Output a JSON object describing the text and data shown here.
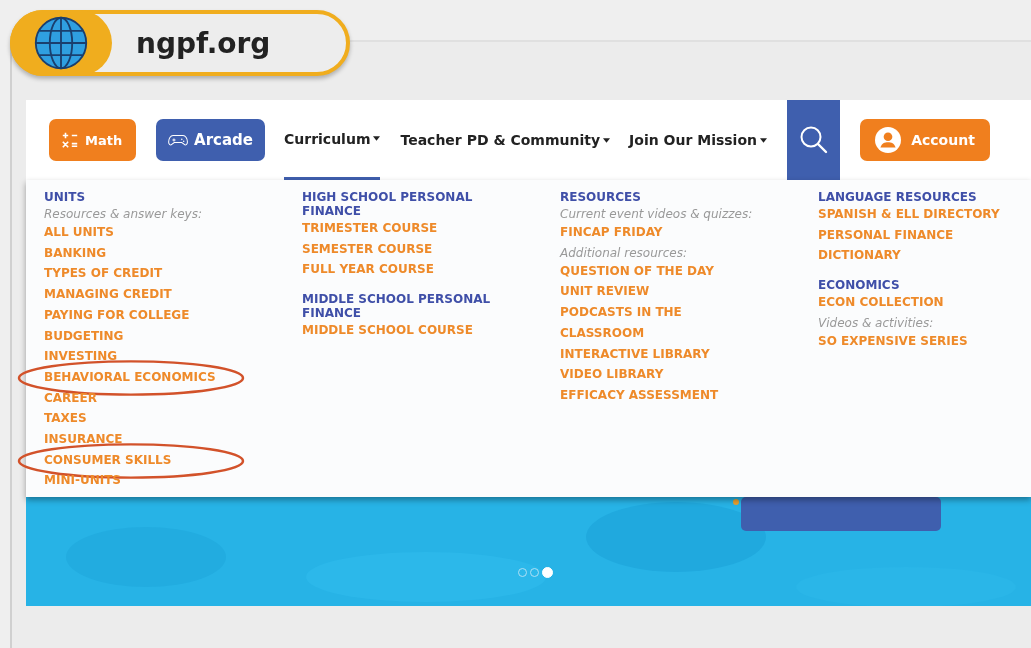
{
  "site_label": {
    "text": "ngpf.org"
  },
  "nav": {
    "buttons": [
      {
        "kind": "math",
        "label": "Math"
      },
      {
        "kind": "arcade",
        "label": "Arcade"
      }
    ],
    "menus": [
      {
        "label": "Curriculum",
        "selected": true
      },
      {
        "label": "Teacher PD & Community",
        "selected": false
      },
      {
        "label": "Join Our Mission",
        "selected": false
      }
    ],
    "account": {
      "label": "Account"
    }
  },
  "dropdown": {
    "columns": [
      {
        "sections": [
          {
            "heading": "UNITS",
            "items": [
              {
                "kind": "note",
                "text": "Resources & answer keys:"
              },
              {
                "kind": "link",
                "text": "ALL UNITS",
                "circled": false
              },
              {
                "kind": "link",
                "text": "BANKING",
                "circled": false
              },
              {
                "kind": "link",
                "text": "TYPES OF CREDIT",
                "circled": false
              },
              {
                "kind": "link",
                "text": "MANAGING CREDIT",
                "circled": false
              },
              {
                "kind": "link",
                "text": "PAYING FOR COLLEGE",
                "circled": false
              },
              {
                "kind": "link",
                "text": "BUDGETING",
                "circled": false
              },
              {
                "kind": "link",
                "text": "INVESTING",
                "circled": false
              },
              {
                "kind": "link",
                "text": "BEHAVIORAL ECONOMICS",
                "circled": true
              },
              {
                "kind": "link",
                "text": "CAREER",
                "circled": false
              },
              {
                "kind": "link",
                "text": "TAXES",
                "circled": false
              },
              {
                "kind": "link",
                "text": "INSURANCE",
                "circled": false
              },
              {
                "kind": "link",
                "text": "CONSUMER SKILLS",
                "circled": true
              },
              {
                "kind": "link",
                "text": "MINI-UNITS",
                "circled": false
              }
            ]
          }
        ]
      },
      {
        "sections": [
          {
            "heading": "HIGH SCHOOL PERSONAL FINANCE",
            "items": [
              {
                "kind": "link",
                "text": "TRIMESTER COURSE",
                "circled": false
              },
              {
                "kind": "link",
                "text": "SEMESTER COURSE",
                "circled": false
              },
              {
                "kind": "link",
                "text": "FULL YEAR COURSE",
                "circled": false
              }
            ]
          },
          {
            "heading": "MIDDLE SCHOOL PERSONAL FINANCE",
            "items": [
              {
                "kind": "link",
                "text": "MIDDLE SCHOOL COURSE",
                "circled": false
              }
            ]
          }
        ]
      },
      {
        "sections": [
          {
            "heading": "RESOURCES",
            "items": [
              {
                "kind": "note",
                "text": "Current event videos & quizzes:"
              },
              {
                "kind": "link",
                "text": "FINCAP FRIDAY",
                "circled": false
              },
              {
                "kind": "note",
                "text": "Additional resources:"
              },
              {
                "kind": "link",
                "text": "QUESTION OF THE DAY",
                "circled": false
              },
              {
                "kind": "link",
                "text": "UNIT REVIEW",
                "circled": false
              },
              {
                "kind": "link",
                "text": "PODCASTS IN THE CLASSROOM",
                "circled": false
              },
              {
                "kind": "link",
                "text": "INTERACTIVE LIBRARY",
                "circled": false
              },
              {
                "kind": "link",
                "text": "VIDEO LIBRARY",
                "circled": false
              },
              {
                "kind": "link",
                "text": "EFFICACY ASSESSMENT",
                "circled": false
              }
            ]
          }
        ]
      },
      {
        "sections": [
          {
            "heading": "LANGUAGE RESOURCES",
            "items": [
              {
                "kind": "link",
                "text": "SPANISH & ELL DIRECTORY",
                "circled": false
              },
              {
                "kind": "link",
                "text": "PERSONAL FINANCE DICTIONARY",
                "circled": false
              }
            ]
          },
          {
            "heading": "ECONOMICS",
            "items": [
              {
                "kind": "link",
                "text": "ECON COLLECTION",
                "circled": false
              },
              {
                "kind": "note",
                "text": "Videos & activities:"
              },
              {
                "kind": "link",
                "text": "SO EXPENSIVE SERIES",
                "circled": false
              }
            ]
          }
        ]
      }
    ]
  },
  "carousel": {
    "dots": [
      {
        "selected": false
      },
      {
        "selected": false
      },
      {
        "selected": true
      }
    ]
  }
}
